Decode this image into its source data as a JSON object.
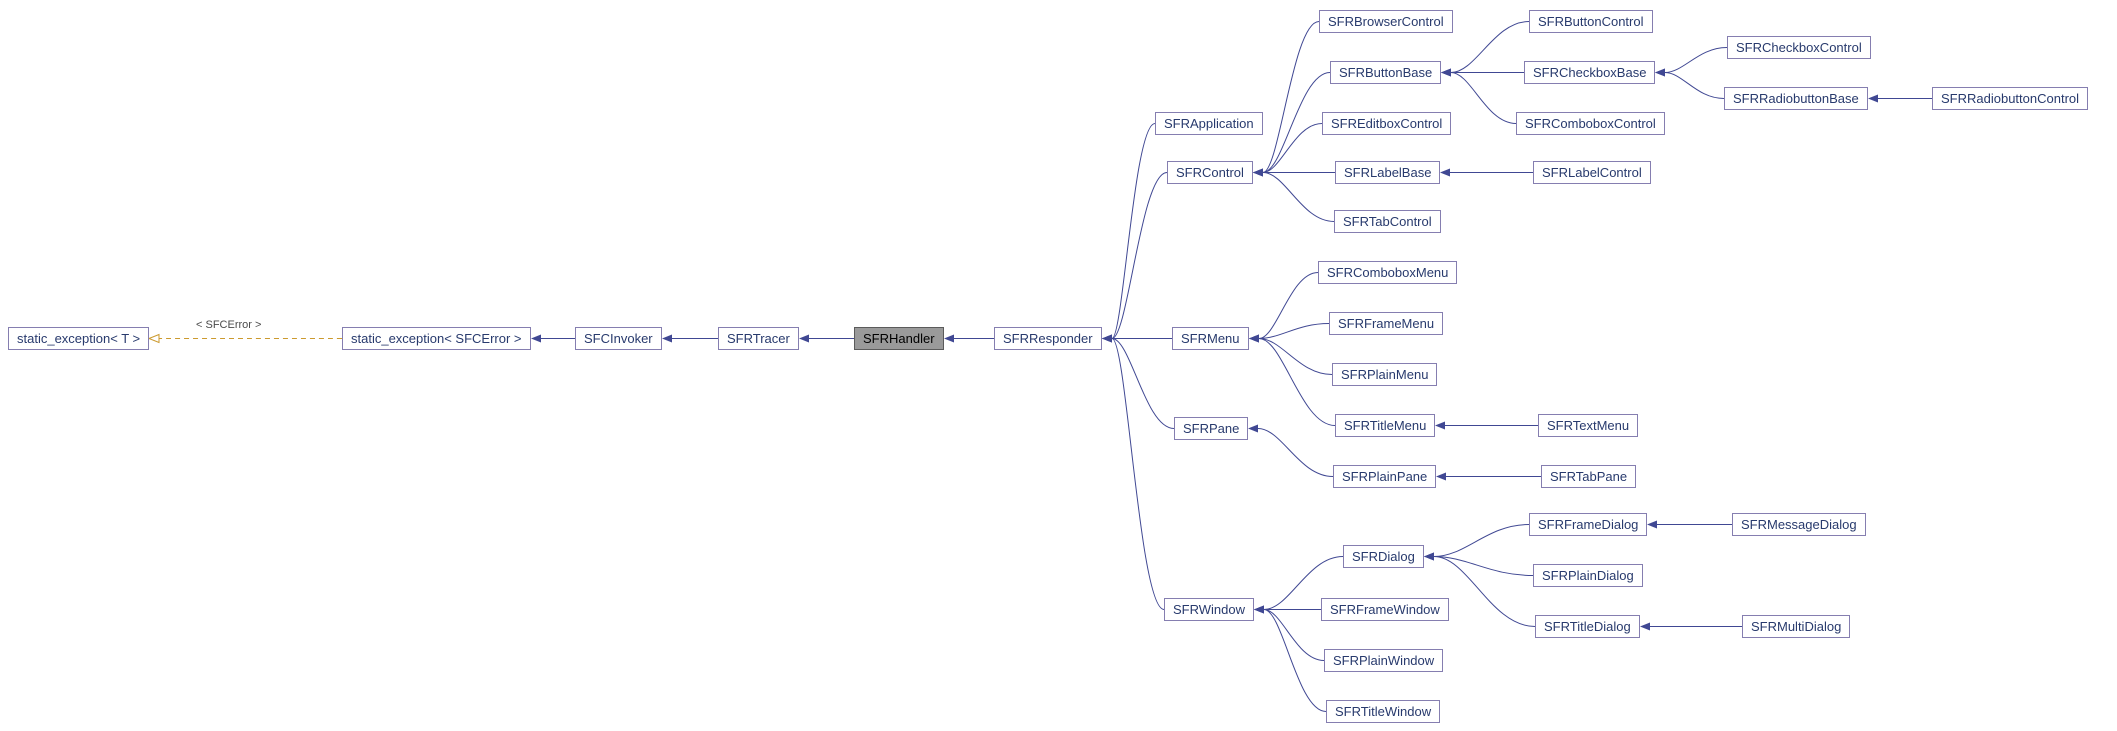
{
  "nodes": {
    "static_exception_T": {
      "label": "static_exception< T >"
    },
    "template_param": {
      "label": "< SFCError >"
    },
    "static_exception_SFCError": {
      "label": "static_exception< SFCError >"
    },
    "SFCInvoker": {
      "label": "SFCInvoker"
    },
    "SFRTracer": {
      "label": "SFRTracer"
    },
    "SFRHandler": {
      "label": "SFRHandler"
    },
    "SFRResponder": {
      "label": "SFRResponder"
    },
    "SFRApplication": {
      "label": "SFRApplication"
    },
    "SFRControl": {
      "label": "SFRControl"
    },
    "SFRMenu": {
      "label": "SFRMenu"
    },
    "SFRPane": {
      "label": "SFRPane"
    },
    "SFRWindow": {
      "label": "SFRWindow"
    },
    "SFRBrowserControl": {
      "label": "SFRBrowserControl"
    },
    "SFRButtonBase": {
      "label": "SFRButtonBase"
    },
    "SFREditboxControl": {
      "label": "SFREditboxControl"
    },
    "SFRLabelBase": {
      "label": "SFRLabelBase"
    },
    "SFRTabControl": {
      "label": "SFRTabControl"
    },
    "SFRButtonControl": {
      "label": "SFRButtonControl"
    },
    "SFRCheckboxBase": {
      "label": "SFRCheckboxBase"
    },
    "SFRComboboxControl": {
      "label": "SFRComboboxControl"
    },
    "SFRLabelControl": {
      "label": "SFRLabelControl"
    },
    "SFRCheckboxControl": {
      "label": "SFRCheckboxControl"
    },
    "SFRRadiobuttonBase": {
      "label": "SFRRadiobuttonBase"
    },
    "SFRRadiobuttonControl": {
      "label": "SFRRadiobuttonControl"
    },
    "SFRComboboxMenu": {
      "label": "SFRComboboxMenu"
    },
    "SFRFrameMenu": {
      "label": "SFRFrameMenu"
    },
    "SFRPlainMenu": {
      "label": "SFRPlainMenu"
    },
    "SFRTitleMenu": {
      "label": "SFRTitleMenu"
    },
    "SFRTextMenu": {
      "label": "SFRTextMenu"
    },
    "SFRPlainPane": {
      "label": "SFRPlainPane"
    },
    "SFRTabPane": {
      "label": "SFRTabPane"
    },
    "SFRDialog": {
      "label": "SFRDialog"
    },
    "SFRFrameWindow": {
      "label": "SFRFrameWindow"
    },
    "SFRPlainWindow": {
      "label": "SFRPlainWindow"
    },
    "SFRTitleWindow": {
      "label": "SFRTitleWindow"
    },
    "SFRFrameDialog": {
      "label": "SFRFrameDialog"
    },
    "SFRPlainDialog": {
      "label": "SFRPlainDialog"
    },
    "SFRTitleDialog": {
      "label": "SFRTitleDialog"
    },
    "SFRMessageDialog": {
      "label": "SFRMessageDialog"
    },
    "SFRMultiDialog": {
      "label": "SFRMultiDialog"
    }
  },
  "edges": [
    {
      "from": "static_exception_SFCError",
      "to": "static_exception_T",
      "style": "dash"
    },
    {
      "from": "SFCInvoker",
      "to": "static_exception_SFCError",
      "style": "solid"
    },
    {
      "from": "SFRTracer",
      "to": "SFCInvoker",
      "style": "solid"
    },
    {
      "from": "SFRHandler",
      "to": "SFRTracer",
      "style": "solid"
    },
    {
      "from": "SFRResponder",
      "to": "SFRHandler",
      "style": "solid"
    },
    {
      "from": "SFRApplication",
      "to": "SFRResponder",
      "style": "solid"
    },
    {
      "from": "SFRControl",
      "to": "SFRResponder",
      "style": "solid"
    },
    {
      "from": "SFRMenu",
      "to": "SFRResponder",
      "style": "solid"
    },
    {
      "from": "SFRPane",
      "to": "SFRResponder",
      "style": "solid"
    },
    {
      "from": "SFRWindow",
      "to": "SFRResponder",
      "style": "solid"
    },
    {
      "from": "SFRBrowserControl",
      "to": "SFRControl",
      "style": "solid"
    },
    {
      "from": "SFRButtonBase",
      "to": "SFRControl",
      "style": "solid"
    },
    {
      "from": "SFREditboxControl",
      "to": "SFRControl",
      "style": "solid"
    },
    {
      "from": "SFRLabelBase",
      "to": "SFRControl",
      "style": "solid"
    },
    {
      "from": "SFRTabControl",
      "to": "SFRControl",
      "style": "solid"
    },
    {
      "from": "SFRButtonControl",
      "to": "SFRButtonBase",
      "style": "solid"
    },
    {
      "from": "SFRCheckboxBase",
      "to": "SFRButtonBase",
      "style": "solid"
    },
    {
      "from": "SFRComboboxControl",
      "to": "SFRButtonBase",
      "style": "solid"
    },
    {
      "from": "SFRCheckboxControl",
      "to": "SFRCheckboxBase",
      "style": "solid"
    },
    {
      "from": "SFRRadiobuttonBase",
      "to": "SFRCheckboxBase",
      "style": "solid"
    },
    {
      "from": "SFRRadiobuttonControl",
      "to": "SFRRadiobuttonBase",
      "style": "solid"
    },
    {
      "from": "SFRLabelControl",
      "to": "SFRLabelBase",
      "style": "solid"
    },
    {
      "from": "SFRComboboxMenu",
      "to": "SFRMenu",
      "style": "solid"
    },
    {
      "from": "SFRFrameMenu",
      "to": "SFRMenu",
      "style": "solid"
    },
    {
      "from": "SFRPlainMenu",
      "to": "SFRMenu",
      "style": "solid"
    },
    {
      "from": "SFRTitleMenu",
      "to": "SFRMenu",
      "style": "solid"
    },
    {
      "from": "SFRTextMenu",
      "to": "SFRTitleMenu",
      "style": "solid"
    },
    {
      "from": "SFRPlainPane",
      "to": "SFRPane",
      "style": "solid"
    },
    {
      "from": "SFRTabPane",
      "to": "SFRPlainPane",
      "style": "solid"
    },
    {
      "from": "SFRDialog",
      "to": "SFRWindow",
      "style": "solid"
    },
    {
      "from": "SFRFrameWindow",
      "to": "SFRWindow",
      "style": "solid"
    },
    {
      "from": "SFRPlainWindow",
      "to": "SFRWindow",
      "style": "solid"
    },
    {
      "from": "SFRTitleWindow",
      "to": "SFRWindow",
      "style": "solid"
    },
    {
      "from": "SFRFrameDialog",
      "to": "SFRDialog",
      "style": "solid"
    },
    {
      "from": "SFRPlainDialog",
      "to": "SFRDialog",
      "style": "solid"
    },
    {
      "from": "SFRTitleDialog",
      "to": "SFRDialog",
      "style": "solid"
    },
    {
      "from": "SFRMessageDialog",
      "to": "SFRFrameDialog",
      "style": "solid"
    },
    {
      "from": "SFRMultiDialog",
      "to": "SFRTitleDialog",
      "style": "solid"
    }
  ],
  "template_label_for_edge": "< SFCError >",
  "chart_data": {
    "type": "inheritance-graph",
    "root": "static_exception< T >",
    "highlighted": "SFRHandler",
    "description": "Doxygen-style class inheritance diagram. Arrows point from derived class to base class. Dashed orange edge is a template instantiation with parameter < SFCError >.",
    "hierarchy": {
      "static_exception< T >": {
        "static_exception< SFCError >": {
          "SFCInvoker": {
            "SFRTracer": {
              "SFRHandler": {
                "SFRResponder": {
                  "SFRApplication": {},
                  "SFRControl": {
                    "SFRBrowserControl": {},
                    "SFRButtonBase": {
                      "SFRButtonControl": {},
                      "SFRCheckboxBase": {
                        "SFRCheckboxControl": {},
                        "SFRRadiobuttonBase": {
                          "SFRRadiobuttonControl": {}
                        }
                      },
                      "SFRComboboxControl": {}
                    },
                    "SFREditboxControl": {},
                    "SFRLabelBase": {
                      "SFRLabelControl": {}
                    },
                    "SFRTabControl": {}
                  },
                  "SFRMenu": {
                    "SFRComboboxMenu": {},
                    "SFRFrameMenu": {},
                    "SFRPlainMenu": {},
                    "SFRTitleMenu": {
                      "SFRTextMenu": {}
                    }
                  },
                  "SFRPane": {
                    "SFRPlainPane": {
                      "SFRTabPane": {}
                    }
                  },
                  "SFRWindow": {
                    "SFRDialog": {
                      "SFRFrameDialog": {
                        "SFRMessageDialog": {}
                      },
                      "SFRPlainDialog": {},
                      "SFRTitleDialog": {
                        "SFRMultiDialog": {}
                      }
                    },
                    "SFRFrameWindow": {},
                    "SFRPlainWindow": {},
                    "SFRTitleWindow": {}
                  }
                }
              }
            }
          }
        }
      }
    }
  }
}
